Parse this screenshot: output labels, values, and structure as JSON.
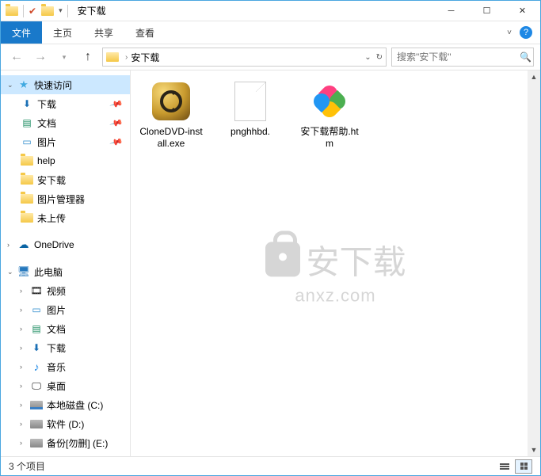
{
  "window": {
    "title": "安下载"
  },
  "ribbon": {
    "file": "文件",
    "tabs": [
      "主页",
      "共享",
      "查看"
    ]
  },
  "address": {
    "path": "安下载"
  },
  "search": {
    "placeholder": "搜索\"安下载\""
  },
  "sidebar": {
    "quick_access": "快速访问",
    "items": [
      {
        "label": "下载",
        "pinned": true,
        "icon": "download"
      },
      {
        "label": "文档",
        "pinned": true,
        "icon": "document"
      },
      {
        "label": "图片",
        "pinned": true,
        "icon": "picture"
      },
      {
        "label": "help",
        "pinned": false,
        "icon": "folder"
      },
      {
        "label": "安下载",
        "pinned": false,
        "icon": "folder"
      },
      {
        "label": "图片管理器",
        "pinned": false,
        "icon": "folder"
      },
      {
        "label": "未上传",
        "pinned": false,
        "icon": "folder"
      }
    ],
    "onedrive": "OneDrive",
    "this_pc": "此电脑",
    "pc_items": [
      {
        "label": "视频",
        "icon": "video"
      },
      {
        "label": "图片",
        "icon": "picture"
      },
      {
        "label": "文档",
        "icon": "document"
      },
      {
        "label": "下载",
        "icon": "download"
      },
      {
        "label": "音乐",
        "icon": "music"
      },
      {
        "label": "桌面",
        "icon": "desktop"
      },
      {
        "label": "本地磁盘 (C:)",
        "icon": "drive-c"
      },
      {
        "label": "软件 (D:)",
        "icon": "drive"
      },
      {
        "label": "备份[勿删] (E:)",
        "icon": "drive"
      }
    ]
  },
  "files": [
    {
      "name": "CloneDVD-install.exe",
      "type": "exe"
    },
    {
      "name": "pnghhbd.",
      "type": "blank"
    },
    {
      "name": "安下载帮助.htm",
      "type": "htm"
    }
  ],
  "watermark": {
    "main": "安下载",
    "sub": "anxz.com"
  },
  "status": {
    "text": "3 个项目"
  }
}
